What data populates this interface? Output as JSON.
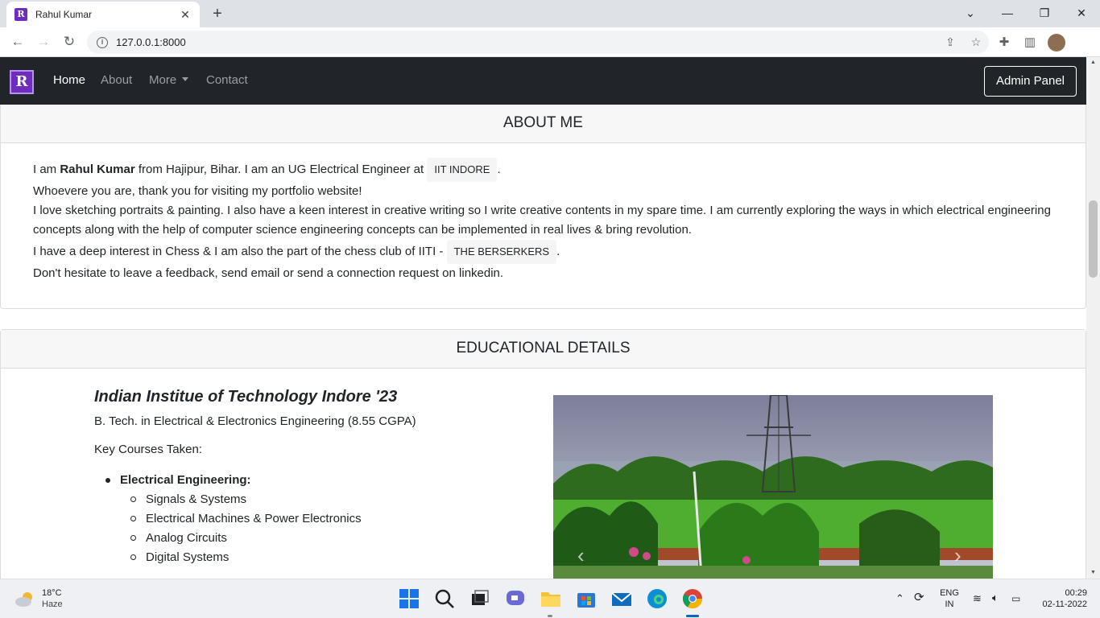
{
  "browser": {
    "tab_title": "Rahul Kumar",
    "tab_close": "✕",
    "new_tab": "+",
    "url": "127.0.0.1:8000",
    "window_controls": [
      "⌄",
      "—",
      "❐",
      "✕"
    ],
    "icons": [
      "back-icon",
      "forward-icon",
      "reload-icon",
      "share-icon",
      "star-icon",
      "extensions-icon",
      "sidepanel-icon",
      "profile-avatar"
    ]
  },
  "navbar": {
    "brand_letter": "R",
    "links": [
      "Home",
      "About",
      "More",
      "Contact"
    ],
    "active": "Home",
    "admin_button": "Admin Panel"
  },
  "about": {
    "header": "ABOUT ME",
    "line1_pre": "I am ",
    "line1_name": "Rahul Kumar",
    "line1_mid": " from Hajipur, Bihar. I am an UG Electrical Engineer at ",
    "line1_badge": "IIT INDORE",
    "line1_post": ".",
    "line2": "Whoevere you are, thank you for visiting my portfolio website!",
    "line3": "I love sketching portraits & painting. I also have a keen interest in creative writing so I write creative contents in my spare time. I am currently exploring the ways in which electrical engineering concepts along with the help of computer science engineering concepts can be implemented in real lives & bring revolution.",
    "line4_pre": "I have a deep interest in Chess & I am also the part of the chess club of IITI - ",
    "line4_badge": "THE BERSERKERS",
    "line4_post": ".",
    "line5": "Don't hesitate to leave a feedback, send email or send a connection request on linkedin."
  },
  "education": {
    "header": "EDUCATIONAL DETAILS",
    "institute": "Indian Institue of Technology Indore '23",
    "degree": "B. Tech. in Electrical & Electronics Engineering (8.55 CGPA)",
    "key_courses_label": "Key Courses Taken:",
    "category": "Electrical Engineering:",
    "courses": [
      "Signals & Systems",
      "Electrical Machines & Power Electronics",
      "Analog Circuits",
      "Digital Systems"
    ],
    "carousel_prev": "‹",
    "carousel_next": "›"
  },
  "taskbar": {
    "temperature": "18°C",
    "condition": "Haze",
    "lang_top": "ENG",
    "lang_bottom": "IN",
    "time": "00:29",
    "date": "02-11-2022"
  }
}
